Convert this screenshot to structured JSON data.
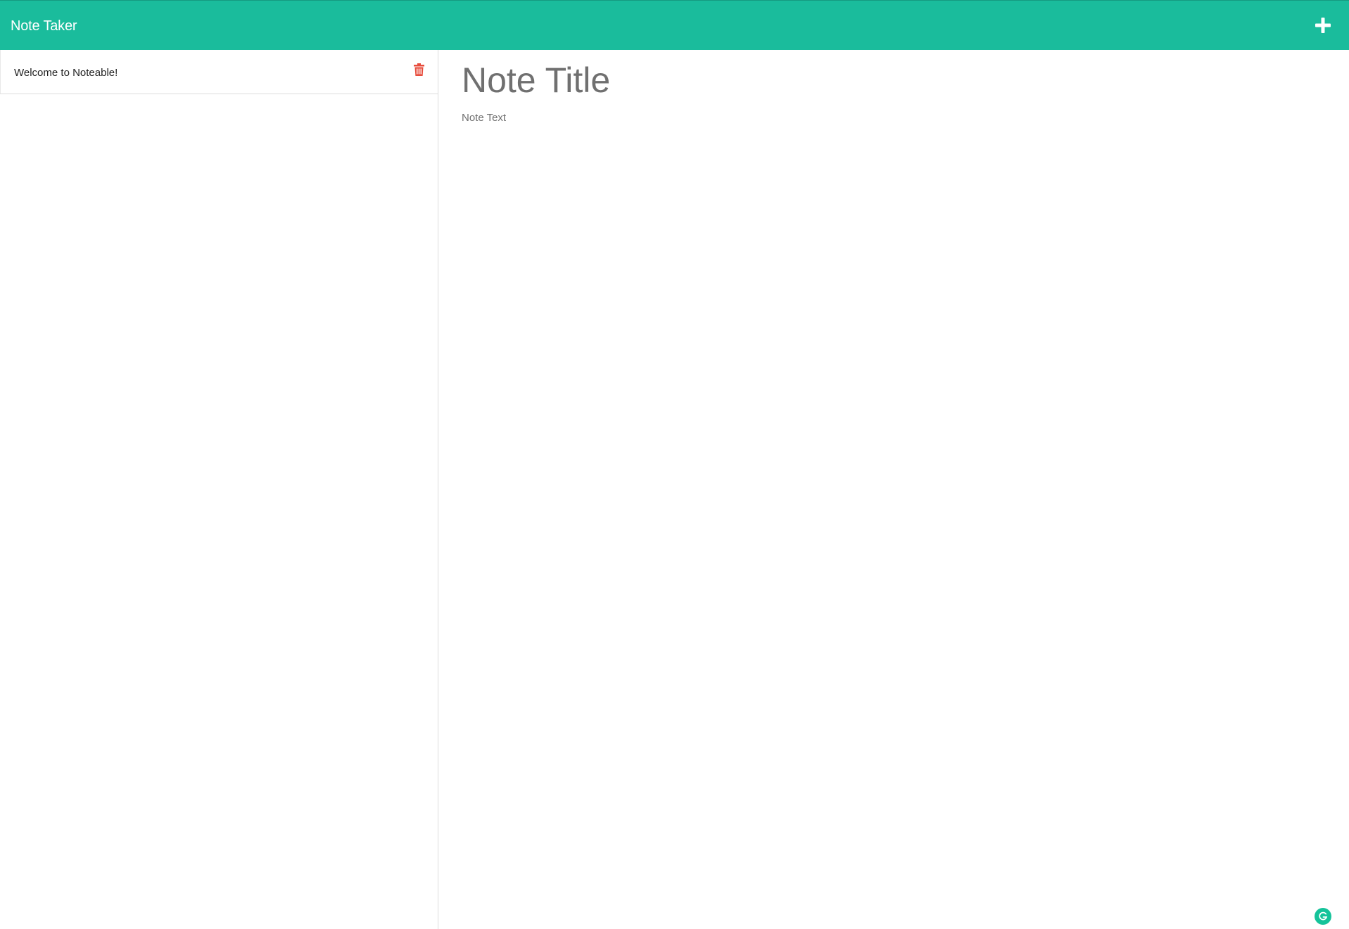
{
  "navbar": {
    "brand": "Note Taker",
    "new_note_icon": "plus-icon",
    "background_color": "#1abc9c"
  },
  "sidebar": {
    "notes": [
      {
        "title": "Welcome to Noteable!",
        "delete_icon": "trash-icon",
        "delete_color": "#e74c3c"
      }
    ]
  },
  "editor": {
    "title_placeholder": "Note Title",
    "text_placeholder": "Note Text"
  },
  "extension": {
    "badge_icon": "grammarly-icon",
    "badge_color": "#15c39a"
  }
}
